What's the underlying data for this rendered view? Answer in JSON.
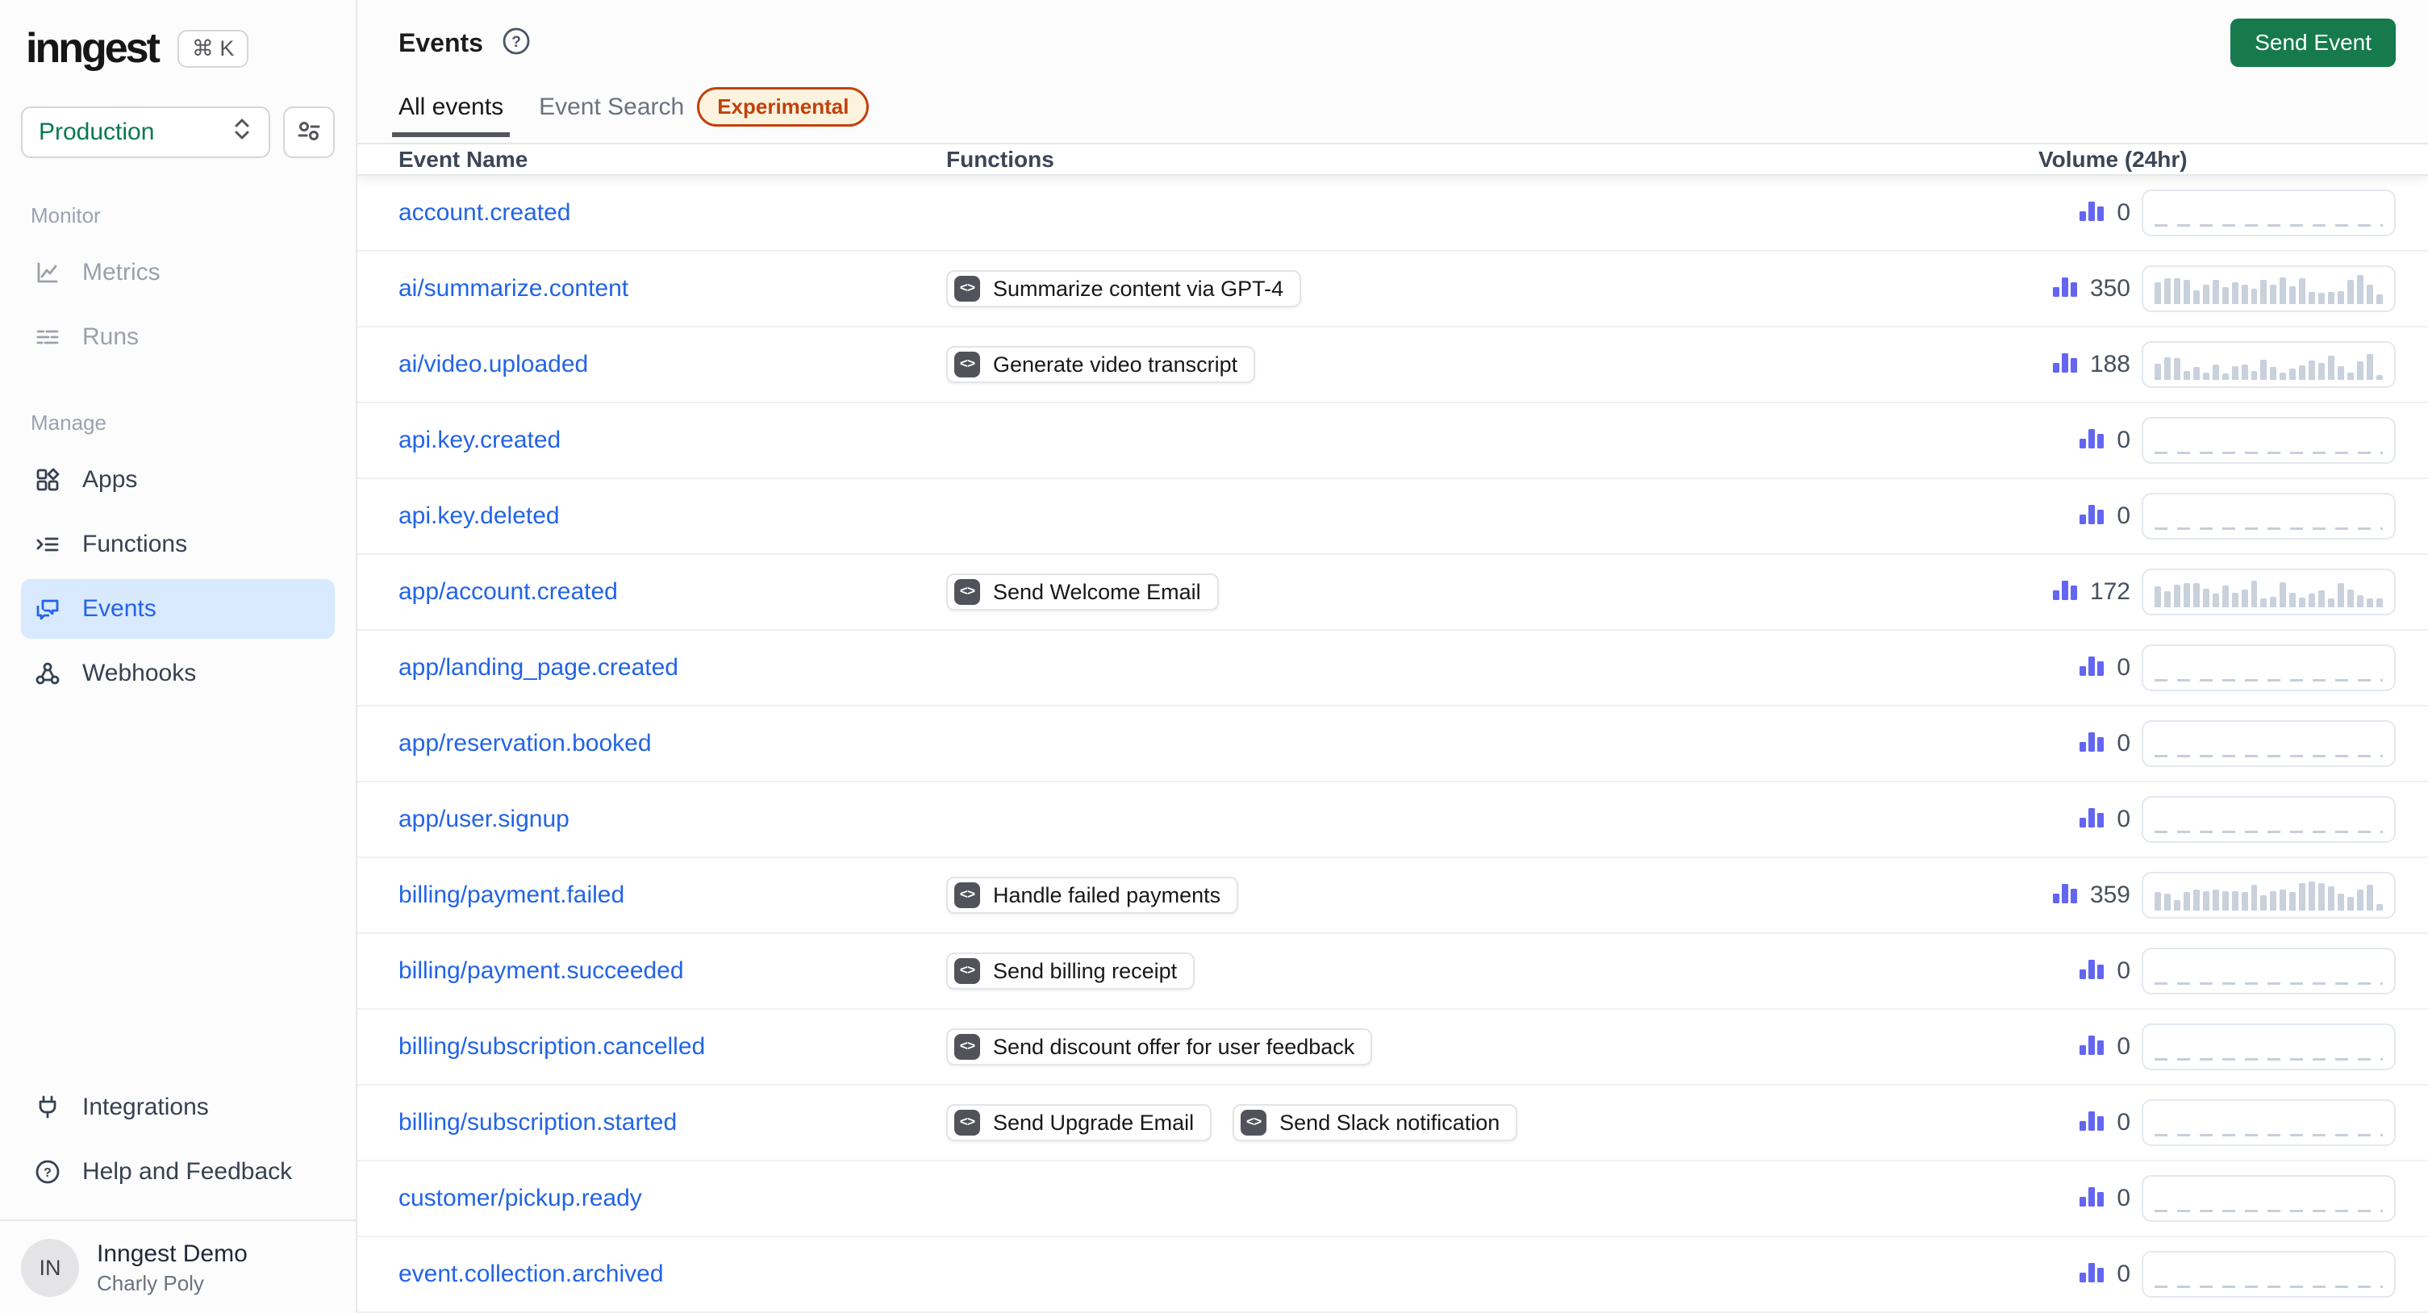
{
  "app": {
    "logo": "inngest",
    "shortcut": "⌘ K",
    "environment": "Production"
  },
  "sidebar": {
    "sections": [
      {
        "label": "Monitor",
        "items": [
          {
            "label": "Metrics"
          },
          {
            "label": "Runs"
          }
        ]
      },
      {
        "label": "Manage",
        "items": [
          {
            "label": "Apps"
          },
          {
            "label": "Functions"
          },
          {
            "label": "Events"
          },
          {
            "label": "Webhooks"
          }
        ]
      }
    ],
    "footer": [
      {
        "label": "Integrations"
      },
      {
        "label": "Help and Feedback"
      }
    ],
    "user": {
      "initials": "IN",
      "name": "Inngest Demo",
      "subtitle": "Charly Poly"
    }
  },
  "header": {
    "title": "Events",
    "send_button": "Send Event",
    "tabs": {
      "all_events": "All events",
      "event_search": "Event Search",
      "experimental_badge": "Experimental"
    }
  },
  "table": {
    "headers": {
      "name": "Event Name",
      "functions": "Functions",
      "volume": "Volume (24hr)"
    },
    "rows": [
      {
        "name": "account.created",
        "functions": [],
        "volume": "0",
        "bars": []
      },
      {
        "name": "ai/summarize.content",
        "functions": [
          "Summarize content via GPT-4"
        ],
        "volume": "350",
        "bars": [
          72,
          85,
          85,
          78,
          45,
          62,
          80,
          55,
          72,
          62,
          50,
          78,
          62,
          88,
          58,
          85,
          40,
          38,
          40,
          42,
          80,
          95,
          62,
          32
        ]
      },
      {
        "name": "ai/video.uploaded",
        "functions": [
          "Generate video transcript"
        ],
        "volume": "188",
        "bars": [
          52,
          75,
          70,
          30,
          42,
          25,
          50,
          22,
          46,
          50,
          30,
          65,
          42,
          25,
          38,
          48,
          62,
          55,
          78,
          45,
          25,
          60,
          85,
          15
        ]
      },
      {
        "name": "api.key.created",
        "functions": [],
        "volume": "0",
        "bars": []
      },
      {
        "name": "api.key.deleted",
        "functions": [],
        "volume": "0",
        "bars": []
      },
      {
        "name": "app/account.created",
        "functions": [
          "Send Welcome Email"
        ],
        "volume": "172",
        "bars": [
          68,
          52,
          75,
          78,
          78,
          60,
          45,
          70,
          48,
          58,
          88,
          30,
          35,
          82,
          48,
          32,
          45,
          55,
          30,
          78,
          58,
          40,
          28,
          30
        ]
      },
      {
        "name": "app/landing_page.created",
        "functions": [],
        "volume": "0",
        "bars": []
      },
      {
        "name": "app/reservation.booked",
        "functions": [],
        "volume": "0",
        "bars": []
      },
      {
        "name": "app/user.signup",
        "functions": [],
        "volume": "0",
        "bars": []
      },
      {
        "name": "billing/payment.failed",
        "functions": [
          "Handle failed payments"
        ],
        "volume": "359",
        "bars": [
          60,
          55,
          35,
          60,
          68,
          64,
          68,
          64,
          64,
          60,
          84,
          50,
          64,
          68,
          60,
          90,
          95,
          90,
          80,
          55,
          45,
          68,
          84,
          20
        ]
      },
      {
        "name": "billing/payment.succeeded",
        "functions": [
          "Send billing receipt"
        ],
        "volume": "0",
        "bars": []
      },
      {
        "name": "billing/subscription.cancelled",
        "functions": [
          "Send discount offer for user feedback"
        ],
        "volume": "0",
        "bars": []
      },
      {
        "name": "billing/subscription.started",
        "functions": [
          "Send Upgrade Email",
          "Send Slack notification"
        ],
        "volume": "0",
        "bars": []
      },
      {
        "name": "customer/pickup.ready",
        "functions": [],
        "volume": "0",
        "bars": []
      },
      {
        "name": "event.collection.archived",
        "functions": [],
        "volume": "0",
        "bars": []
      }
    ]
  },
  "colors": {
    "accent_green": "#167a4c",
    "env_green": "#077a4b",
    "link_blue": "#2264e5",
    "indigo": "#6366f1",
    "experimental_orange": "#c2410c",
    "active_nav_bg": "#d9eafe"
  }
}
